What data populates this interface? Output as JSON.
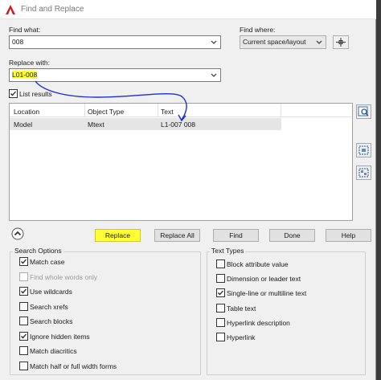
{
  "window": {
    "title": "Find and Replace"
  },
  "find_what": {
    "label": "Find what:",
    "value": "008"
  },
  "find_where": {
    "label": "Find where:",
    "value": "Current space/layout"
  },
  "replace_with": {
    "label": "Replace with:",
    "value": "L01-008"
  },
  "list_results": {
    "label": "List results",
    "checked": true
  },
  "results_table": {
    "headers": [
      "Location",
      "Object Type",
      "Text"
    ],
    "rows": [
      {
        "location": "Model",
        "object_type": "Mtext",
        "text": "L1-007 008"
      }
    ]
  },
  "buttons": {
    "replace": "Replace",
    "replace_all": "Replace All",
    "find": "Find",
    "done": "Done",
    "help": "Help"
  },
  "search_options": {
    "title": "Search Options",
    "items": [
      {
        "label": "Match case",
        "checked": true,
        "enabled": true
      },
      {
        "label": "Find whole words only",
        "checked": false,
        "enabled": false
      },
      {
        "label": "Use wildcards",
        "checked": true,
        "enabled": true
      },
      {
        "label": "Search xrefs",
        "checked": false,
        "enabled": true
      },
      {
        "label": "Search blocks",
        "checked": false,
        "enabled": true
      },
      {
        "label": "Ignore hidden items",
        "checked": true,
        "enabled": true
      },
      {
        "label": "Match diacritics",
        "checked": false,
        "enabled": true
      },
      {
        "label": "Match half or full width forms",
        "checked": false,
        "enabled": true
      }
    ]
  },
  "text_types": {
    "title": "Text Types",
    "items": [
      {
        "label": "Block attribute value",
        "checked": false
      },
      {
        "label": "Dimension or leader text",
        "checked": false
      },
      {
        "label": "Single-line or multiline text",
        "checked": true
      },
      {
        "label": "Table text",
        "checked": false
      },
      {
        "label": "Hyperlink description",
        "checked": false
      },
      {
        "label": "Hyperlink",
        "checked": false
      }
    ]
  },
  "colors": {
    "highlight": "#ffff33",
    "annotation": "#1a2fd0",
    "app_icon": "#cc1a1a"
  }
}
